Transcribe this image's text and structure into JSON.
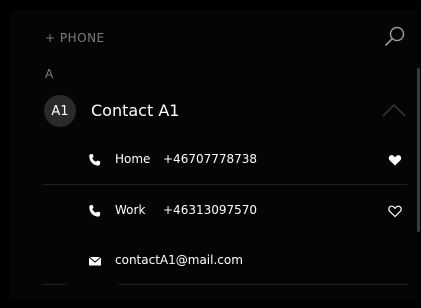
{
  "header": {
    "add_phone_label": "+ PHONE",
    "search_icon": "search-icon"
  },
  "list": {
    "section_letter": "A",
    "contact": {
      "avatar_initials": "A1",
      "name": "Contact A1",
      "expanded": true,
      "entries": [
        {
          "kind": "phone",
          "type": "Home",
          "value": "+46707778738",
          "favorite": true
        },
        {
          "kind": "phone",
          "type": "Work",
          "value": "+46313097570",
          "favorite": false
        },
        {
          "kind": "email",
          "value": "contactA1@mail.com"
        }
      ]
    }
  },
  "colors": {
    "background": "#000000",
    "text": "#ffffff",
    "muted": "#7d7d7d",
    "avatar_bg": "#2a2a2a",
    "divider": "#1f1f1f"
  }
}
